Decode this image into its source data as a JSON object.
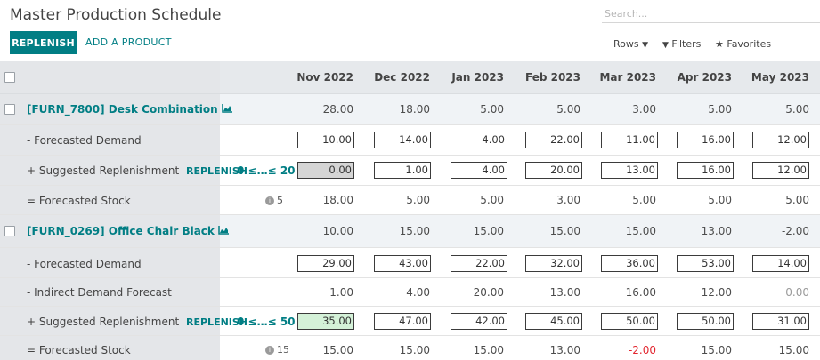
{
  "header": {
    "title": "Master Production Schedule",
    "search_placeholder": "Search...",
    "replenish_label": "REPLENISH",
    "add_product_label": "ADD A PRODUCT",
    "rows_label": "Rows",
    "filters_label": "Filters",
    "favorites_label": "Favorites"
  },
  "months": [
    "Nov 2022",
    "Dec 2022",
    "Jan 2023",
    "Feb 2023",
    "Mar 2023",
    "Apr 2023",
    "May 2023"
  ],
  "products": [
    {
      "name": "[FURN_7800] Desk Combination",
      "totals": [
        "28.00",
        "18.00",
        "5.00",
        "5.00",
        "3.00",
        "5.00",
        "5.00"
      ],
      "forecast_label": "- Forecasted Demand",
      "forecast": [
        "10.00",
        "14.00",
        "4.00",
        "22.00",
        "11.00",
        "16.00",
        "12.00"
      ],
      "replenish_label": "+ Suggested Replenishment",
      "replenish_link": "REPLENISH",
      "range": "0 ≤…≤ 20",
      "replenish": [
        "0.00",
        "1.00",
        "4.00",
        "20.00",
        "13.00",
        "16.00",
        "12.00"
      ],
      "stock_label": "= Forecasted Stock",
      "stock_info": "5",
      "stock": [
        "18.00",
        "5.00",
        "5.00",
        "3.00",
        "5.00",
        "5.00",
        "5.00"
      ]
    },
    {
      "name": "[FURN_0269] Office Chair Black",
      "totals": [
        "10.00",
        "15.00",
        "15.00",
        "15.00",
        "15.00",
        "13.00",
        "-2.00"
      ],
      "forecast_label": "- Forecasted Demand",
      "forecast": [
        "29.00",
        "43.00",
        "22.00",
        "32.00",
        "36.00",
        "53.00",
        "14.00"
      ],
      "indirect_label": "- Indirect Demand Forecast",
      "indirect": [
        "1.00",
        "4.00",
        "20.00",
        "13.00",
        "16.00",
        "12.00",
        "0.00"
      ],
      "replenish_label": "+ Suggested Replenishment",
      "replenish_link": "REPLENISH",
      "range": "0 ≤…≤ 50",
      "replenish": [
        "35.00",
        "47.00",
        "42.00",
        "45.00",
        "50.00",
        "50.00",
        "31.00"
      ],
      "stock_label": "= Forecasted Stock",
      "stock_info": "15",
      "stock": [
        "15.00",
        "15.00",
        "15.00",
        "13.00",
        "-2.00",
        "15.00",
        "15.00"
      ]
    }
  ],
  "colors": {
    "accent": "#017e84",
    "negative": "#e2262f",
    "grey_cell": "#d5d5d5",
    "green_cell": "#d4f1d8"
  }
}
